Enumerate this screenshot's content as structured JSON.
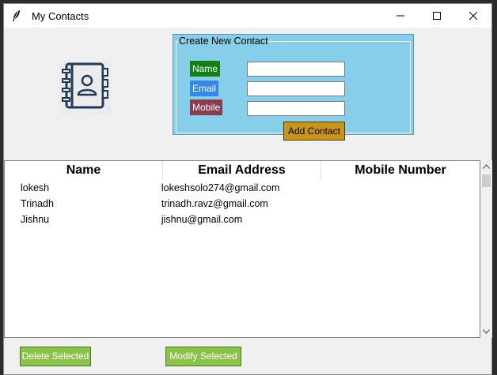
{
  "window": {
    "title": "My Contacts"
  },
  "form": {
    "legend": "Create New Contact",
    "name_label": "Name",
    "email_label": "Email",
    "mobile_label": "Mobile",
    "name_value": "",
    "email_value": "",
    "mobile_value": "",
    "add_button": "Add Contact"
  },
  "table": {
    "columns": [
      "Name",
      "Email Address",
      "Mobile Number"
    ],
    "rows": [
      {
        "name": "lokesh",
        "email": "lokeshsolo274@gmail.com",
        "mobile": ""
      },
      {
        "name": "Trinadh",
        "email": "trinadh.ravz@gmail.com",
        "mobile": ""
      },
      {
        "name": "Jishnu",
        "email": "jishnu@gmail.com",
        "mobile": ""
      }
    ]
  },
  "actions": {
    "delete_label": "Delete Selected",
    "modify_label": "Modify Selected"
  },
  "colors": {
    "form_bg": "#87ceeb",
    "name_label_bg": "#138013",
    "email_label_bg": "#3388e6",
    "mobile_label_bg": "#8b3a50",
    "add_button_bg": "#c8941a",
    "action_button_bg": "#8bc34a"
  },
  "icons": {
    "app": "feather-icon",
    "contacts": "address-book-icon"
  }
}
